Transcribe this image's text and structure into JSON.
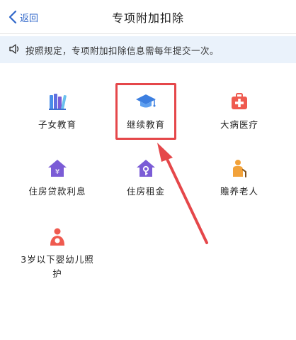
{
  "header": {
    "back_label": "返回",
    "title": "专项附加扣除"
  },
  "notice": {
    "text": "按照规定，专项附加扣除信息需每年提交一次。"
  },
  "grid": {
    "items": [
      {
        "label": "子女教育",
        "icon": "books-icon"
      },
      {
        "label": "继续教育",
        "icon": "graduation-cap-icon"
      },
      {
        "label": "大病医疗",
        "icon": "medical-kit-icon"
      },
      {
        "label": "住房贷款利息",
        "icon": "house-yen-icon"
      },
      {
        "label": "住房租金",
        "icon": "house-key-icon"
      },
      {
        "label": "赡养老人",
        "icon": "elderly-person-icon"
      },
      {
        "label": "3岁以下婴幼儿照护",
        "icon": "mother-baby-icon"
      }
    ]
  },
  "colors": {
    "accent": "#2f66c9",
    "notice_bg": "#eaf2fb",
    "icon_purple": "#7b5cd6",
    "icon_orange": "#f2a23a",
    "icon_red": "#ef5a4f",
    "annotation_red": "#e5474a"
  }
}
